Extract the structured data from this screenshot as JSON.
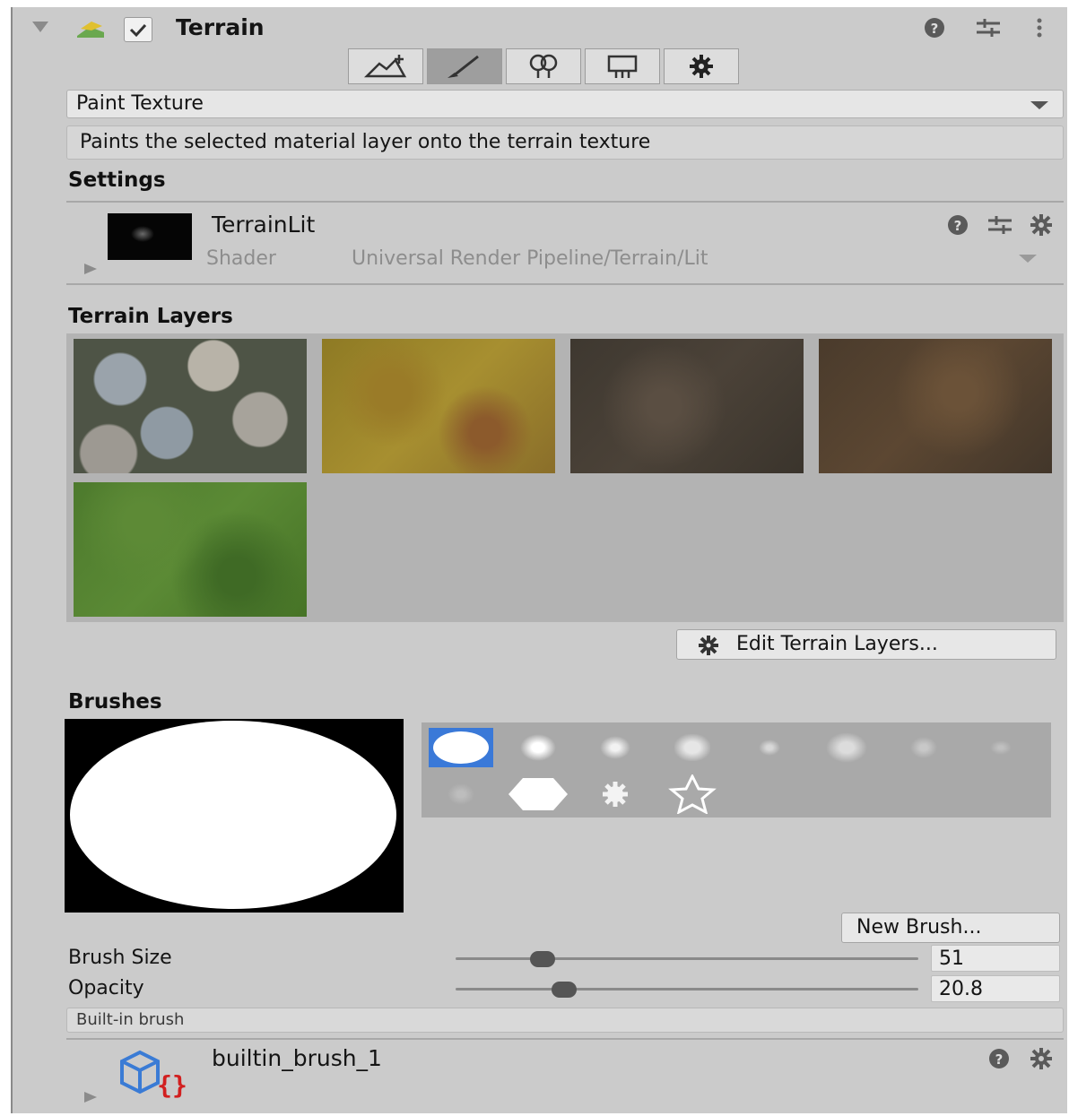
{
  "header": {
    "title": "Terrain",
    "enabled": true
  },
  "tool_tabs": [
    {
      "name": "raise-lower",
      "icon": "terrain-sculpt-icon",
      "selected": false
    },
    {
      "name": "paint",
      "icon": "paint-brush-icon",
      "selected": true
    },
    {
      "name": "trees",
      "icon": "tree-icon",
      "selected": false
    },
    {
      "name": "details",
      "icon": "grass-detail-icon",
      "selected": false
    },
    {
      "name": "settings",
      "icon": "gear-icon",
      "selected": false
    }
  ],
  "mode_dropdown": {
    "value": "Paint Texture"
  },
  "description": "Paints the selected material layer onto the terrain texture",
  "settings": {
    "heading": "Settings",
    "material_name": "TerrainLit",
    "shader_label": "Shader",
    "shader_value": "Universal Render Pipeline/Terrain/Lit"
  },
  "terrain_layers": {
    "heading": "Terrain Layers",
    "layers": [
      "rocks",
      "dry-grass",
      "dark-dirt",
      "brown-dirt",
      "green-grass"
    ],
    "edit_button": "Edit Terrain Layers..."
  },
  "brushes": {
    "heading": "Brushes",
    "selected_index": 0,
    "new_brush_button": "New Brush...",
    "brush_size_label": "Brush Size",
    "brush_size_value": "51",
    "brush_size_fraction": 0.17,
    "opacity_label": "Opacity",
    "opacity_value": "20.8",
    "opacity_fraction": 0.22,
    "builtin_label": "Built-in brush",
    "asset_name": "builtin_brush_1"
  },
  "colors": {
    "panel_bg": "#cbcbcb",
    "selection": "#3a79d8"
  }
}
